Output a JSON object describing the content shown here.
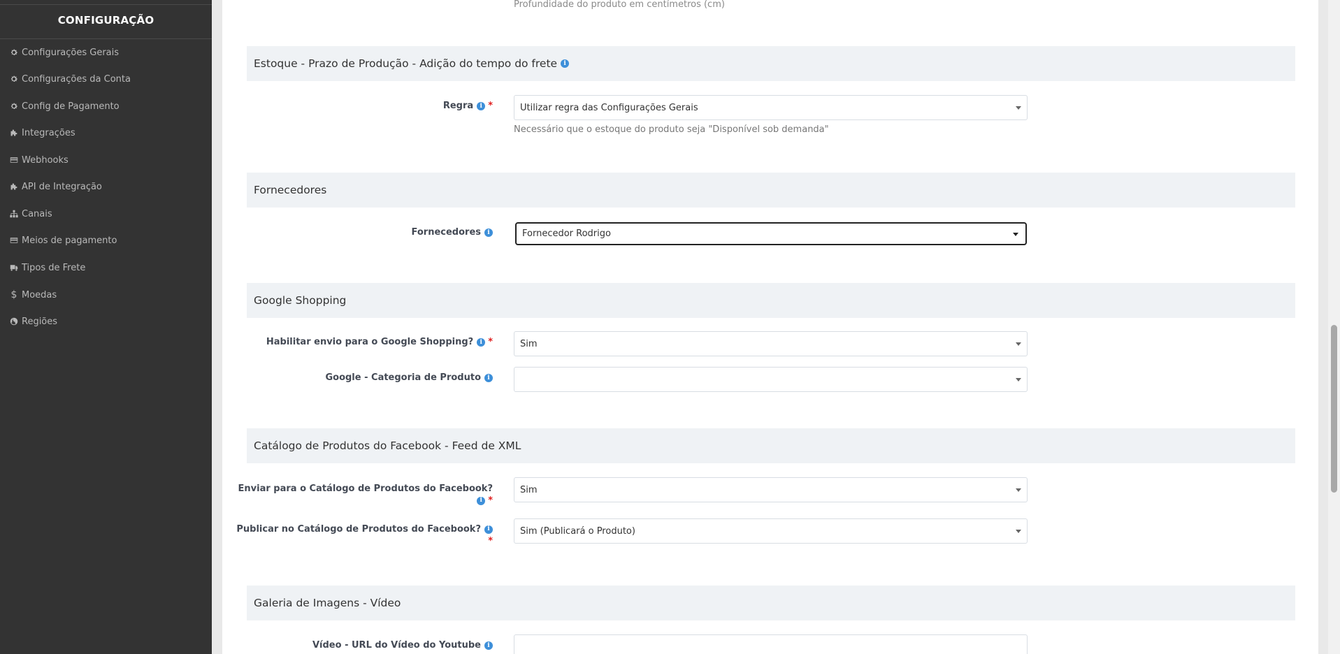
{
  "sidebar": {
    "title": "CONFIGURAÇÃO",
    "items": [
      {
        "label": "Configurações Gerais",
        "icon": "gear-icon"
      },
      {
        "label": "Configurações da Conta",
        "icon": "gear-icon"
      },
      {
        "label": "Config de Pagamento",
        "icon": "gear-icon"
      },
      {
        "label": "Integrações",
        "icon": "puzzle-icon"
      },
      {
        "label": "Webhooks",
        "icon": "card-icon"
      },
      {
        "label": "API de Integração",
        "icon": "puzzle-icon"
      },
      {
        "label": "Canais",
        "icon": "sitemap-icon"
      },
      {
        "label": "Meios de pagamento",
        "icon": "card-icon"
      },
      {
        "label": "Tipos de Frete",
        "icon": "truck-icon"
      },
      {
        "label": "Moedas",
        "icon": "dollar-icon"
      },
      {
        "label": "Regiões",
        "icon": "globe-icon"
      }
    ]
  },
  "top_hint": "Profundidade do produto em centímetros (cm)",
  "sections": {
    "estoque": {
      "title": "Estoque - Prazo de Produção - Adição do tempo do frete",
      "regra_label": "Regra",
      "regra_value": "Utilizar regra das Configurações Gerais",
      "regra_hint": "Necessário que o estoque do produto seja \"Disponível sob demanda\""
    },
    "fornecedores": {
      "title": "Fornecedores",
      "label": "Fornecedores",
      "value": "Fornecedor Rodrigo"
    },
    "google": {
      "title": "Google Shopping",
      "habilitar_label": "Habilitar envio para o Google Shopping?",
      "habilitar_value": "Sim",
      "categoria_label": "Google - Categoria de Produto",
      "categoria_value": ""
    },
    "facebook": {
      "title": "Catálogo de Produtos do Facebook - Feed de XML",
      "enviar_label": "Enviar para o Catálogo de Produtos do Facebook?",
      "enviar_value": "Sim",
      "publicar_label": "Publicar no Catálogo de Produtos do Facebook?",
      "publicar_value": "Sim (Publicará o Produto)"
    },
    "galeria": {
      "title": "Galeria de Imagens - Vídeo",
      "video_label": "Vídeo - URL do Vídeo do Youtube",
      "video_value": ""
    }
  },
  "colors": {
    "sidebar_bg": "#333333",
    "section_bg": "#eff2f5",
    "info_blue": "#3d8fd9",
    "required_red": "#e02020"
  }
}
